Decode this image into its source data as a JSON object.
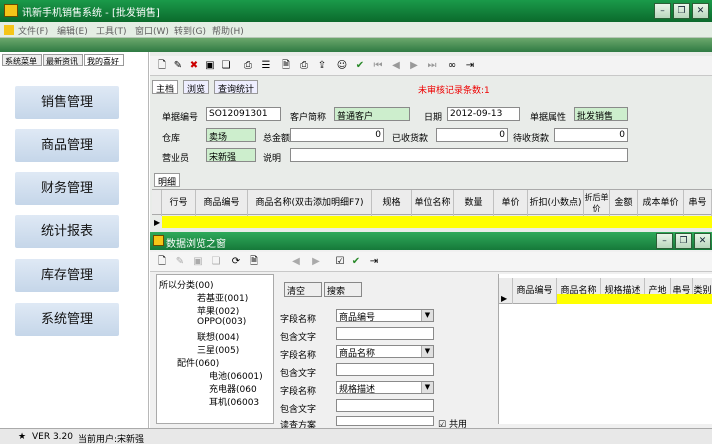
{
  "window": {
    "title": "讯新手机销售系统 - [批发销售]",
    "min": "–",
    "restore": "❐",
    "close": "✕"
  },
  "menu": [
    "文件(F)",
    "编辑(E)",
    "工具(T)",
    "窗口(W)",
    "转到(G)",
    "帮助(H)"
  ],
  "left_tabs": [
    "系统菜单",
    "最新资讯",
    "我的喜好"
  ],
  "nav": [
    "销售管理",
    "商品管理",
    "财务管理",
    "统计报表",
    "库存管理",
    "系统管理"
  ],
  "tabs": [
    "主档",
    "浏览",
    "查询统计"
  ],
  "warning": "未审核记录条数:1",
  "form": {
    "doc_no_label": "单据编号",
    "doc_no": "SO12091301",
    "customer_label": "客户简称",
    "customer": "普通客户",
    "date_label": "日期",
    "date": "2012-09-13",
    "doc_attr_label": "单据属性",
    "doc_attr": "批发销售",
    "warehouse_label": "仓库",
    "warehouse": "卖场",
    "total_label": "总金额",
    "total": "0",
    "received_label": "已收货款",
    "received": "0",
    "pending_label": "待收货款",
    "pending": "0",
    "salesman_label": "营业员",
    "salesman": "宋新强",
    "note_label": "说明",
    "note": ""
  },
  "detail_tab": "明细",
  "grid_headers": [
    "行号",
    "商品编号",
    "商品名称(双击添加明细F7)",
    "规格",
    "单位名称",
    "数量",
    "单价",
    "折扣(小数点)",
    "折后单价",
    "金额",
    "成本单价",
    "串号"
  ],
  "browser": {
    "title": "数据浏览之窗",
    "clear": "清空",
    "search": "搜索",
    "tree": [
      "所以分类(00)",
      "若基亚(001)",
      "苹果(002)",
      "OPPO(003)",
      "联想(004)",
      "三星(005)",
      "配件(060)",
      "电池(06001)",
      "充电器(060",
      "耳机(06003"
    ],
    "fields": [
      {
        "label": "字段名称",
        "value": "商品编号"
      },
      {
        "label": "包含文字",
        "value": ""
      },
      {
        "label": "字段名称",
        "value": "商品名称"
      },
      {
        "label": "包含文字",
        "value": ""
      },
      {
        "label": "字段名称",
        "value": "规格描述"
      },
      {
        "label": "包含文字",
        "value": ""
      },
      {
        "label": "读查方案",
        "value": ""
      }
    ],
    "share": "共用",
    "grid_headers": [
      "商品编号",
      "商品名称",
      "规格描述",
      "产地",
      "串号",
      "类别"
    ]
  },
  "status": {
    "version": "VER 3.20",
    "user": "当前用户:宋新强"
  },
  "colors": {
    "title": "#0b6a2c",
    "nav": "#c5d6e9",
    "input_green": "#cdeecd",
    "yellow": "#ffff00",
    "warn": "#e00000"
  }
}
